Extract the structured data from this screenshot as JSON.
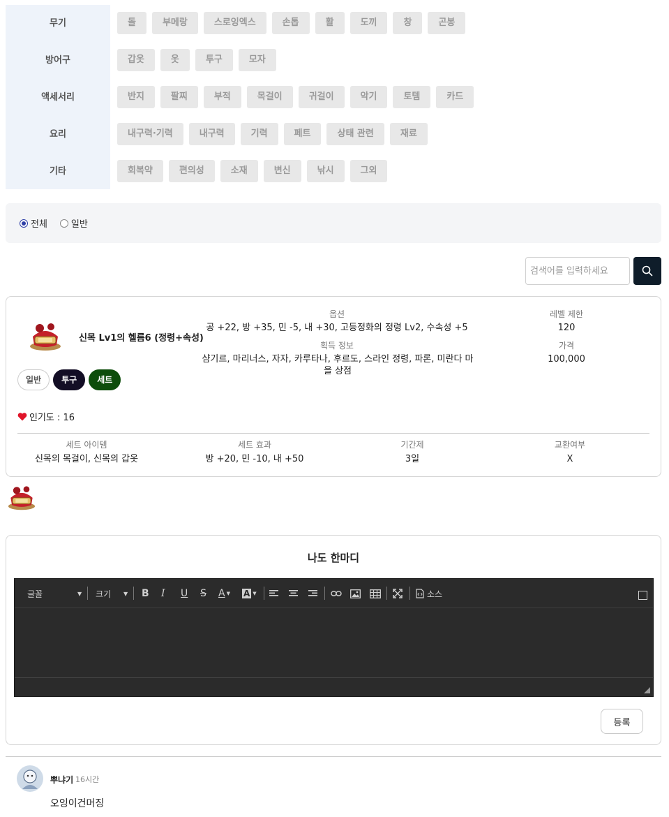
{
  "categories": [
    {
      "label": "무기",
      "items": [
        "돌",
        "부메랑",
        "스로잉엑스",
        "손톱",
        "활",
        "도끼",
        "창",
        "곤봉"
      ]
    },
    {
      "label": "방어구",
      "items": [
        "갑옷",
        "옷",
        "투구",
        "모자"
      ]
    },
    {
      "label": "액세서리",
      "items": [
        "반지",
        "팔찌",
        "부적",
        "목걸이",
        "귀걸이",
        "악기",
        "토템",
        "카드"
      ]
    },
    {
      "label": "요리",
      "items": [
        "내구력·기력",
        "내구력",
        "기력",
        "페트",
        "상태 관련",
        "재료"
      ]
    },
    {
      "label": "기타",
      "items": [
        "회복약",
        "편의성",
        "소재",
        "변신",
        "낚시",
        "그외"
      ]
    }
  ],
  "filter": {
    "options": [
      "전체",
      "일반"
    ],
    "selected": "전체"
  },
  "search": {
    "placeholder": "검색어를 입력하세요"
  },
  "item": {
    "name": "신목 Lv1의 헬름6 (정령+속성)",
    "option_label": "옵션",
    "option_value": "공 +22, 방 +35, 민 -5, 내 +30, 고등정화의 정령 Lv2, 수속성 +5",
    "obtain_label": "획득 정보",
    "obtain_value": "샴기르, 마리너스, 자자, 카루타나, 후르도, 스라인 정령, 파론, 미란다 마을 상점",
    "level_label": "레벨 제한",
    "level_value": "120",
    "price_label": "가격",
    "price_value": "100,000",
    "tags": [
      "일반",
      "투구",
      "세트"
    ],
    "popularity_text": "인기도 : 16",
    "set_item_label": "세트 아이템",
    "set_item_value": "신목의 목걸이, 신목의 갑옷",
    "set_effect_label": "세트 효과",
    "set_effect_value": "방 +20, 민 -10, 내 +50",
    "period_label": "기간제",
    "period_value": "3일",
    "trade_label": "교환여부",
    "trade_value": "X"
  },
  "comment_section": {
    "title": "나도 한마디",
    "toolbar": {
      "font": "글꼴",
      "size": "크기",
      "source": "소스"
    },
    "submit": "등록"
  },
  "comments": [
    {
      "user": "뿌냐기",
      "time": "16시간",
      "text": "오잉이건머징"
    }
  ],
  "colors": {
    "accent_dark": "#0f1d2a",
    "tag_dark": "#130e25",
    "tag_green": "#0d4d0b",
    "heart": "#e0152a",
    "category_bg": "#eef3fa"
  }
}
